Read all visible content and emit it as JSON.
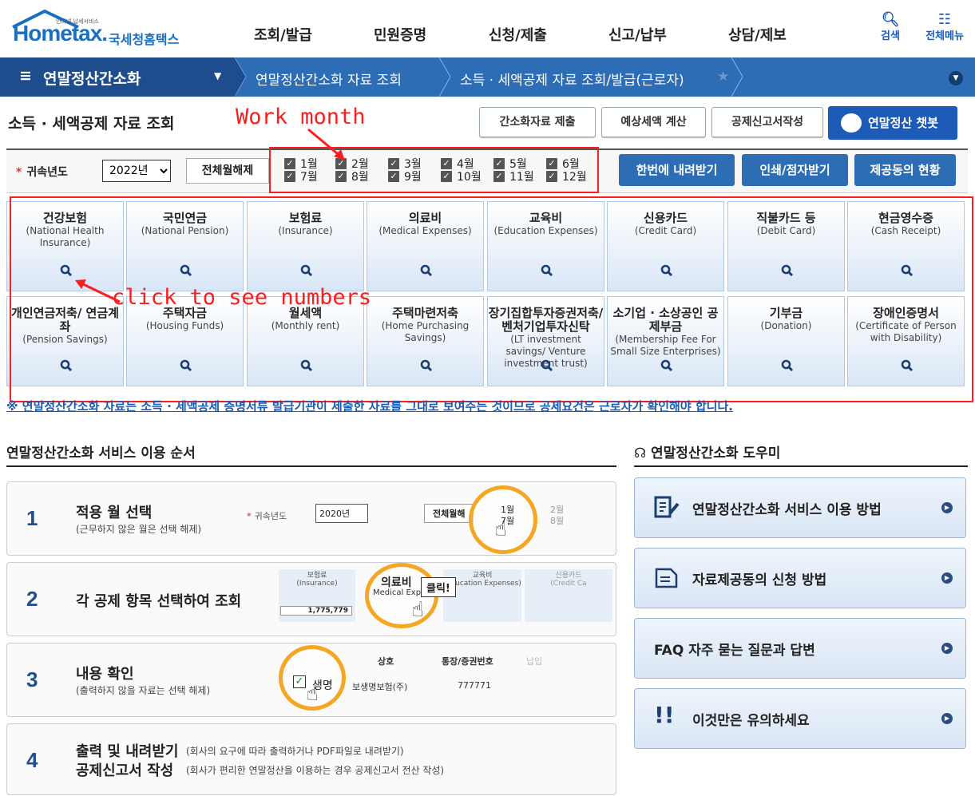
{
  "header": {
    "logo_tag": "인터넷 납세서비스",
    "logo_word": "Hometax.",
    "logo_sub": "국세청홈택스",
    "nav": [
      "조회/발급",
      "민원증명",
      "신청/제출",
      "신고/납부",
      "상담/제보"
    ],
    "search": "검색",
    "allmenu": "전체메뉴"
  },
  "bar": {
    "menu": "연말정산간소화",
    "crumb1": "연말정산간소화 자료 조회",
    "crumb2": "소득 · 세액공제 자료 조회/발급(근로자)"
  },
  "page": {
    "title": "소득 · 세액공제 자료 조회",
    "btn_submit": "간소화자료 제출",
    "btn_estimate": "예상세액 계산",
    "btn_form": "공제신고서작성",
    "btn_chat": "연말정산 챗봇"
  },
  "filter": {
    "year_label": "귀속년도",
    "year": "2022년",
    "clear": "전체월해제",
    "months": [
      "1월",
      "2월",
      "3월",
      "4월",
      "5월",
      "6월",
      "7월",
      "8월",
      "9월",
      "10월",
      "11월",
      "12월"
    ],
    "btn_download": "한번에 내려받기",
    "btn_print": "인쇄/점자받기",
    "btn_status": "제공동의 현황"
  },
  "annotations": {
    "work": "Work month",
    "click": "click to see numbers"
  },
  "tiles": [
    {
      "ko": "건강보험",
      "en": "(National Health Insurance)"
    },
    {
      "ko": "국민연금",
      "en": "(National Pension)"
    },
    {
      "ko": "보험료",
      "en": "(Insurance)"
    },
    {
      "ko": "의료비",
      "en": "(Medical Expenses)"
    },
    {
      "ko": "교육비",
      "en": "(Education Expenses)"
    },
    {
      "ko": "신용카드",
      "en": "(Credit Card)"
    },
    {
      "ko": "직불카드 등",
      "en": "(Debit Card)"
    },
    {
      "ko": "현금영수증",
      "en": "(Cash Receipt)"
    },
    {
      "ko": "개인연금저축/ 연금계좌",
      "en": "(Pension Savings)"
    },
    {
      "ko": "주택자금",
      "en": "(Housing Funds)"
    },
    {
      "ko": "월세액",
      "en": "(Monthly rent)"
    },
    {
      "ko": "주택마련저축",
      "en": "(Home Purchasing Savings)"
    },
    {
      "ko": "장기집합투자증권저축/ 벤처기업투자신탁",
      "en": "(LT investment savings/ Venture investment trust)"
    },
    {
      "ko": "소기업 · 소상공인 공제부금",
      "en": "(Membership Fee For Small Size Enterprises)"
    },
    {
      "ko": "기부금",
      "en": "(Donation)"
    },
    {
      "ko": "장애인증명서",
      "en": "(Certificate of Person with Disability)"
    }
  ],
  "notice": "※ 연말정산간소화 자료는 소득 · 세액공제 증명서류 발급기관이 제출한 자료를 그대로 보여주는 것이므로 공제요건은 근로자가 확인해야 합니다.",
  "guide": {
    "title": "연말정산간소화 서비스 이용 순서",
    "steps": [
      {
        "n": "1",
        "h": "적용 월 선택",
        "s": "(근무하지 않은 월은 선택 해제)"
      },
      {
        "n": "2",
        "h": "각 공제 항목 선택하여 조회",
        "s": ""
      },
      {
        "n": "3",
        "h": "내용 확인",
        "s": "(출력하지 않을 자료는 선택 해제)"
      },
      {
        "n": "4",
        "h": "출력 및 내려받기",
        "s": "(회사의 요구에 따라 출력하거나 PDF파일로 내려받기)",
        "h2": "공제신고서 작성",
        "s2": "(회사가 편리한 연말정산을 이용하는 경우 공제신고서 전산 작성)"
      }
    ]
  },
  "illus": {
    "s1_year_label": "귀속년도",
    "s1_year": "2020년",
    "s1_clear": "전체월해",
    "s1_m": [
      "1월",
      "2월",
      "7월",
      "8월"
    ],
    "s2_tiles": [
      "보험료",
      "의료비",
      "교육비",
      "신용카드"
    ],
    "s2_en": [
      "(Insurance)",
      "Medical Expen",
      "(Education Expenses)",
      "(Credit Ca"
    ],
    "s2_amount": "1,775,779",
    "s2_click": "클릭!",
    "s3_cols": [
      "상호",
      "통장/증권번호",
      "납입"
    ],
    "s3_row1": "생명",
    "s3_row1b": "보생명보험(주)",
    "s3_num": "777771"
  },
  "helper": {
    "title": "연말정산간소화 도우미",
    "items": [
      "연말정산간소화 서비스 이용 방법",
      "자료제공동의 신청 방법",
      "FAQ 자주 묻는 질문과 답변",
      "이것만은 유의하세요"
    ]
  }
}
